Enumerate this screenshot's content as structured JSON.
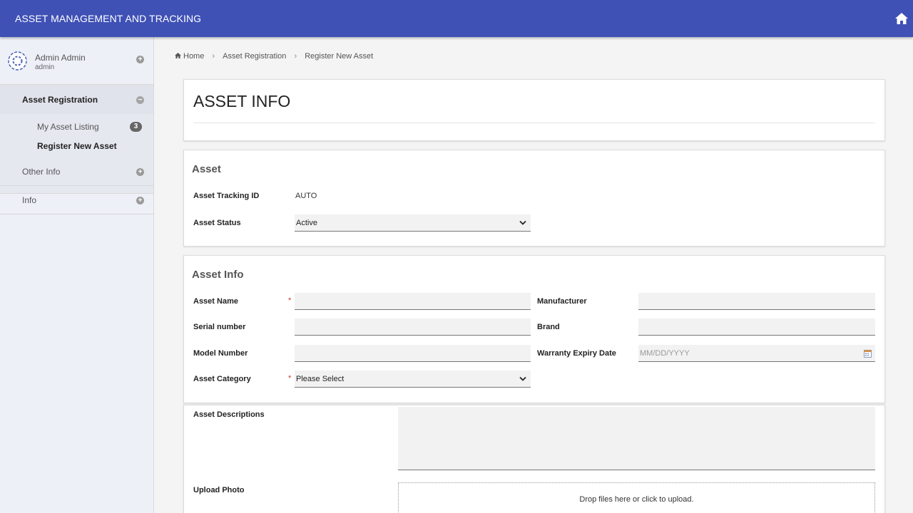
{
  "app": {
    "title": "ASSET MANAGEMENT AND TRACKING"
  },
  "icons": {
    "home": "home-icon",
    "avatar": "avatar-icon",
    "expand": "plus-circle-icon",
    "collapse": "minus-circle-icon"
  },
  "colors": {
    "topbar": "#3f51b5",
    "sidebar": "#eef0f8",
    "required": "#c0392b"
  },
  "user": {
    "name": "Admin Admin",
    "role": "admin"
  },
  "sidebar": {
    "section": {
      "label": "Asset Registration",
      "items": [
        {
          "label": "My Asset Listing",
          "badge": "3"
        },
        {
          "label": "Register New Asset"
        }
      ]
    },
    "other_info": "Other Info",
    "info": "Info"
  },
  "breadcrumb": {
    "home": "Home",
    "level1": "Asset Registration",
    "level2": "Register New Asset"
  },
  "page": {
    "title": "ASSET INFO"
  },
  "asset": {
    "section_title": "Asset",
    "tracking_id_label": "Asset Tracking ID",
    "tracking_id_value": "AUTO",
    "status_label": "Asset Status",
    "status_value": "Active"
  },
  "asset_info": {
    "section_title": "Asset Info",
    "name_label": "Asset Name",
    "required_mark": "*",
    "serial_label": "Serial number",
    "model_label": "Model Number",
    "category_label": "Asset Category",
    "category_value": "Please Select",
    "manufacturer_label": "Manufacturer",
    "brand_label": "Brand",
    "warranty_label": "Warranty Expiry Date",
    "warranty_placeholder": "MM/DD/YYYY"
  },
  "extra": {
    "descriptions_label": "Asset Descriptions",
    "upload_label": "Upload Photo",
    "dropzone_text": "Drop files here or click to upload."
  }
}
